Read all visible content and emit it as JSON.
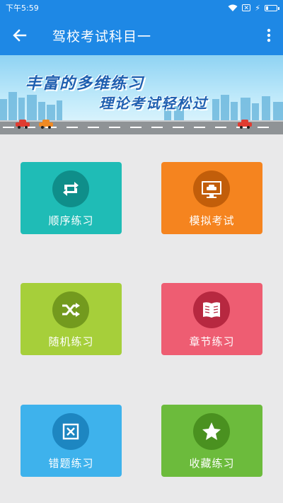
{
  "status": {
    "time": "下午5:59"
  },
  "appbar": {
    "title": "驾校考试科目一"
  },
  "banner": {
    "line1": "丰富的多维练习",
    "line2": "理论考试轻松过"
  },
  "tiles": [
    {
      "label": "顺序练习",
      "color": "#1fbcb6",
      "circle": "#0f8e8a",
      "icon": "repeat-icon"
    },
    {
      "label": "模拟考试",
      "color": "#f5841f",
      "circle": "#c25e0a",
      "icon": "monitor-car-icon"
    },
    {
      "label": "随机练习",
      "color": "#a6cf3a",
      "circle": "#739a1e",
      "icon": "shuffle-icon"
    },
    {
      "label": "章节练习",
      "color": "#ee5d72",
      "circle": "#b72840",
      "icon": "book-icon"
    },
    {
      "label": "错题练习",
      "color": "#3eb2ec",
      "circle": "#1d86c1",
      "icon": "close-box-icon"
    },
    {
      "label": "收藏练习",
      "color": "#6cbb3c",
      "circle": "#4a9120",
      "icon": "star-icon"
    }
  ]
}
